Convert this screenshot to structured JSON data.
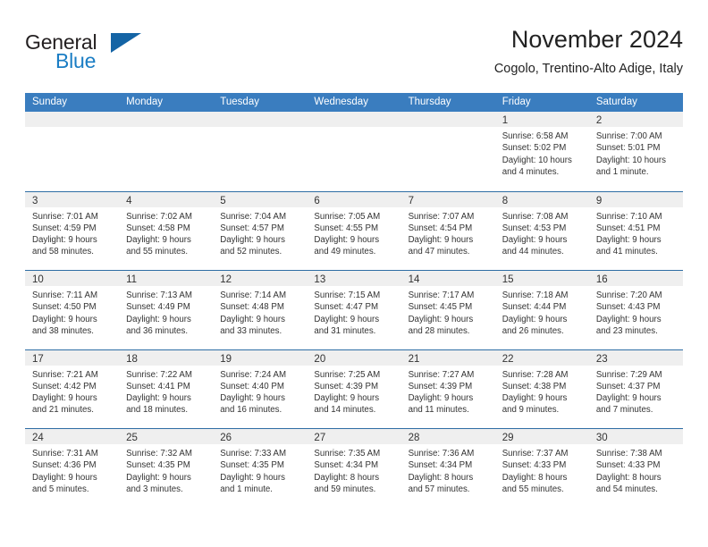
{
  "logo": {
    "word_top": "General",
    "word_bottom": "Blue",
    "triangle_icon": "blue-triangle-icon",
    "accent_color": "#1464a5",
    "text_color": "#231f20"
  },
  "header": {
    "title": "November 2024",
    "subtitle": "Cogolo, Trentino-Alto Adige, Italy"
  },
  "theme": {
    "weekday_bar_color": "#3a7dbf",
    "row_divider_color": "#2e6da4",
    "day_head_color": "#efefef",
    "text_color": "#333333"
  },
  "weekdays": [
    "Sunday",
    "Monday",
    "Tuesday",
    "Wednesday",
    "Thursday",
    "Friday",
    "Saturday"
  ],
  "weeks": [
    [
      {
        "day": "",
        "empty": true
      },
      {
        "day": "",
        "empty": true
      },
      {
        "day": "",
        "empty": true
      },
      {
        "day": "",
        "empty": true
      },
      {
        "day": "",
        "empty": true
      },
      {
        "day": "1",
        "sunrise": "Sunrise: 6:58 AM",
        "sunset": "Sunset: 5:02 PM",
        "daylight1": "Daylight: 10 hours",
        "daylight2": "and 4 minutes."
      },
      {
        "day": "2",
        "sunrise": "Sunrise: 7:00 AM",
        "sunset": "Sunset: 5:01 PM",
        "daylight1": "Daylight: 10 hours",
        "daylight2": "and 1 minute."
      }
    ],
    [
      {
        "day": "3",
        "sunrise": "Sunrise: 7:01 AM",
        "sunset": "Sunset: 4:59 PM",
        "daylight1": "Daylight: 9 hours",
        "daylight2": "and 58 minutes."
      },
      {
        "day": "4",
        "sunrise": "Sunrise: 7:02 AM",
        "sunset": "Sunset: 4:58 PM",
        "daylight1": "Daylight: 9 hours",
        "daylight2": "and 55 minutes."
      },
      {
        "day": "5",
        "sunrise": "Sunrise: 7:04 AM",
        "sunset": "Sunset: 4:57 PM",
        "daylight1": "Daylight: 9 hours",
        "daylight2": "and 52 minutes."
      },
      {
        "day": "6",
        "sunrise": "Sunrise: 7:05 AM",
        "sunset": "Sunset: 4:55 PM",
        "daylight1": "Daylight: 9 hours",
        "daylight2": "and 49 minutes."
      },
      {
        "day": "7",
        "sunrise": "Sunrise: 7:07 AM",
        "sunset": "Sunset: 4:54 PM",
        "daylight1": "Daylight: 9 hours",
        "daylight2": "and 47 minutes."
      },
      {
        "day": "8",
        "sunrise": "Sunrise: 7:08 AM",
        "sunset": "Sunset: 4:53 PM",
        "daylight1": "Daylight: 9 hours",
        "daylight2": "and 44 minutes."
      },
      {
        "day": "9",
        "sunrise": "Sunrise: 7:10 AM",
        "sunset": "Sunset: 4:51 PM",
        "daylight1": "Daylight: 9 hours",
        "daylight2": "and 41 minutes."
      }
    ],
    [
      {
        "day": "10",
        "sunrise": "Sunrise: 7:11 AM",
        "sunset": "Sunset: 4:50 PM",
        "daylight1": "Daylight: 9 hours",
        "daylight2": "and 38 minutes."
      },
      {
        "day": "11",
        "sunrise": "Sunrise: 7:13 AM",
        "sunset": "Sunset: 4:49 PM",
        "daylight1": "Daylight: 9 hours",
        "daylight2": "and 36 minutes."
      },
      {
        "day": "12",
        "sunrise": "Sunrise: 7:14 AM",
        "sunset": "Sunset: 4:48 PM",
        "daylight1": "Daylight: 9 hours",
        "daylight2": "and 33 minutes."
      },
      {
        "day": "13",
        "sunrise": "Sunrise: 7:15 AM",
        "sunset": "Sunset: 4:47 PM",
        "daylight1": "Daylight: 9 hours",
        "daylight2": "and 31 minutes."
      },
      {
        "day": "14",
        "sunrise": "Sunrise: 7:17 AM",
        "sunset": "Sunset: 4:45 PM",
        "daylight1": "Daylight: 9 hours",
        "daylight2": "and 28 minutes."
      },
      {
        "day": "15",
        "sunrise": "Sunrise: 7:18 AM",
        "sunset": "Sunset: 4:44 PM",
        "daylight1": "Daylight: 9 hours",
        "daylight2": "and 26 minutes."
      },
      {
        "day": "16",
        "sunrise": "Sunrise: 7:20 AM",
        "sunset": "Sunset: 4:43 PM",
        "daylight1": "Daylight: 9 hours",
        "daylight2": "and 23 minutes."
      }
    ],
    [
      {
        "day": "17",
        "sunrise": "Sunrise: 7:21 AM",
        "sunset": "Sunset: 4:42 PM",
        "daylight1": "Daylight: 9 hours",
        "daylight2": "and 21 minutes."
      },
      {
        "day": "18",
        "sunrise": "Sunrise: 7:22 AM",
        "sunset": "Sunset: 4:41 PM",
        "daylight1": "Daylight: 9 hours",
        "daylight2": "and 18 minutes."
      },
      {
        "day": "19",
        "sunrise": "Sunrise: 7:24 AM",
        "sunset": "Sunset: 4:40 PM",
        "daylight1": "Daylight: 9 hours",
        "daylight2": "and 16 minutes."
      },
      {
        "day": "20",
        "sunrise": "Sunrise: 7:25 AM",
        "sunset": "Sunset: 4:39 PM",
        "daylight1": "Daylight: 9 hours",
        "daylight2": "and 14 minutes."
      },
      {
        "day": "21",
        "sunrise": "Sunrise: 7:27 AM",
        "sunset": "Sunset: 4:39 PM",
        "daylight1": "Daylight: 9 hours",
        "daylight2": "and 11 minutes."
      },
      {
        "day": "22",
        "sunrise": "Sunrise: 7:28 AM",
        "sunset": "Sunset: 4:38 PM",
        "daylight1": "Daylight: 9 hours",
        "daylight2": "and 9 minutes."
      },
      {
        "day": "23",
        "sunrise": "Sunrise: 7:29 AM",
        "sunset": "Sunset: 4:37 PM",
        "daylight1": "Daylight: 9 hours",
        "daylight2": "and 7 minutes."
      }
    ],
    [
      {
        "day": "24",
        "sunrise": "Sunrise: 7:31 AM",
        "sunset": "Sunset: 4:36 PM",
        "daylight1": "Daylight: 9 hours",
        "daylight2": "and 5 minutes."
      },
      {
        "day": "25",
        "sunrise": "Sunrise: 7:32 AM",
        "sunset": "Sunset: 4:35 PM",
        "daylight1": "Daylight: 9 hours",
        "daylight2": "and 3 minutes."
      },
      {
        "day": "26",
        "sunrise": "Sunrise: 7:33 AM",
        "sunset": "Sunset: 4:35 PM",
        "daylight1": "Daylight: 9 hours",
        "daylight2": "and 1 minute."
      },
      {
        "day": "27",
        "sunrise": "Sunrise: 7:35 AM",
        "sunset": "Sunset: 4:34 PM",
        "daylight1": "Daylight: 8 hours",
        "daylight2": "and 59 minutes."
      },
      {
        "day": "28",
        "sunrise": "Sunrise: 7:36 AM",
        "sunset": "Sunset: 4:34 PM",
        "daylight1": "Daylight: 8 hours",
        "daylight2": "and 57 minutes."
      },
      {
        "day": "29",
        "sunrise": "Sunrise: 7:37 AM",
        "sunset": "Sunset: 4:33 PM",
        "daylight1": "Daylight: 8 hours",
        "daylight2": "and 55 minutes."
      },
      {
        "day": "30",
        "sunrise": "Sunrise: 7:38 AM",
        "sunset": "Sunset: 4:33 PM",
        "daylight1": "Daylight: 8 hours",
        "daylight2": "and 54 minutes."
      }
    ]
  ]
}
